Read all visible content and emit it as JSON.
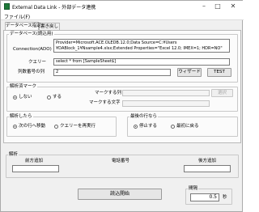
{
  "window": {
    "title": "External Data Link - 外部データ連携",
    "controls": {
      "minimize": "–",
      "maximize": "□",
      "close": "✕"
    }
  },
  "menu": {
    "file": "ファイル(F)"
  },
  "tabs": [
    {
      "label": "データベース指定"
    },
    {
      "label": "書き戻し"
    }
  ],
  "database": {
    "group_label": "データベース(読込用)",
    "connection_label": "Connection(ADO)",
    "connection_line1": "Provider=Microsoft.ACE.OLEDB.12.0;Data Source=C:¥Users",
    "connection_line2": "¥DABlock_1¥Nsample4.xlsx;Extended Properties=\"Excel 12.0; IMEX=1; HDR=NO\"",
    "query_label": "クエリー",
    "query_value": "select * from [SampleSheet$]",
    "col_count_label": "列数番号の列",
    "col_count_value": "2",
    "wizard_button": "ウィザード",
    "test_button": "TEST"
  },
  "marker": {
    "group_label": "解析済マーク",
    "option_none": "しない",
    "option_do": "する",
    "mark_col_label": "マークする列",
    "mark_col_value": "",
    "mark_text_label": "マークする文字",
    "mark_text_value": "",
    "select_button": "選択"
  },
  "after_parse": {
    "group_label": "解析したら",
    "option_next": "次の行へ移動",
    "option_rerun": "クエリーを再実行"
  },
  "last_row": {
    "group_label": "最後の行なら",
    "option_stop": "停止する",
    "option_first": "最初に戻る"
  },
  "parse": {
    "group_label": "解析",
    "front_add_label": "前方追加",
    "front_add_value": "",
    "phone_label": "電話番号",
    "back_add_label": "後方追加",
    "back_add_value": ""
  },
  "start_button": "読込開始",
  "interval": {
    "group_label": "間隔",
    "value": "0.5",
    "unit": "秒"
  }
}
